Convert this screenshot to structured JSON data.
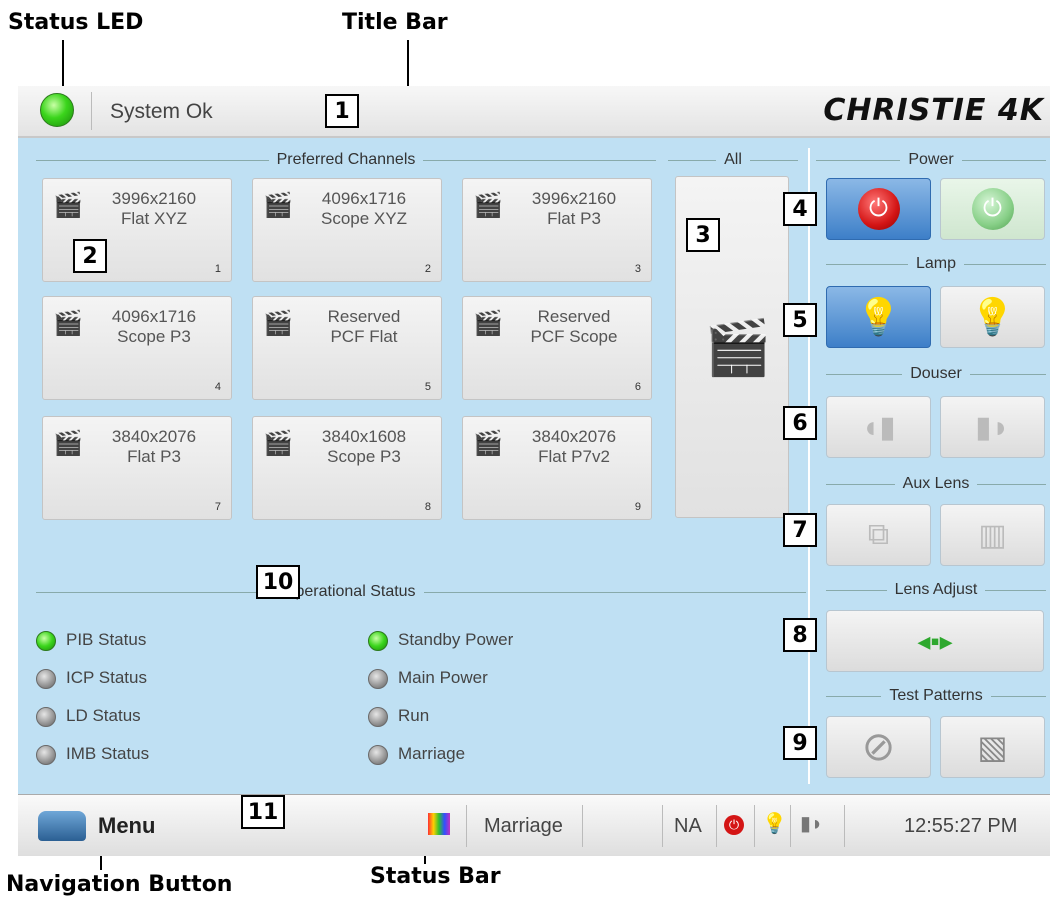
{
  "annotations": {
    "status_led": "Status LED",
    "title_bar": "Title Bar",
    "navigation_button": "Navigation Button",
    "status_bar": "Status Bar",
    "callout_numbers": [
      "1",
      "2",
      "3",
      "4",
      "5",
      "6",
      "7",
      "8",
      "9",
      "10",
      "11"
    ]
  },
  "title_bar": {
    "status_text": "System Ok",
    "brand": "CHRISTIE 4K",
    "status_led_color": "#3bd51c"
  },
  "preferred_channels": {
    "header": "Preferred Channels",
    "items": [
      {
        "line1": "3996x2160",
        "line2": "Flat XYZ",
        "number": "1"
      },
      {
        "line1": "4096x1716",
        "line2": "Scope XYZ",
        "number": "2"
      },
      {
        "line1": "3996x2160",
        "line2": "Flat P3",
        "number": "3"
      },
      {
        "line1": "4096x1716",
        "line2": "Scope P3",
        "number": "4"
      },
      {
        "line1": "Reserved",
        "line2": "PCF Flat",
        "number": "5"
      },
      {
        "line1": "Reserved",
        "line2": "PCF Scope",
        "number": "6"
      },
      {
        "line1": "3840x2076",
        "line2": "Flat P3",
        "number": "7"
      },
      {
        "line1": "3840x1608",
        "line2": "Scope P3",
        "number": "8"
      },
      {
        "line1": "3840x2076",
        "line2": "Flat P7v2",
        "number": "9"
      }
    ],
    "icon": "clapperboard-icon"
  },
  "all": {
    "header": "All",
    "icon": "clapperboards-icon"
  },
  "controls": {
    "power": {
      "header": "Power",
      "off_icon": "power-off-icon",
      "on_icon": "power-on-icon"
    },
    "lamp": {
      "header": "Lamp",
      "off_icon": "lamp-off-icon",
      "on_icon": "lamp-on-icon"
    },
    "douser": {
      "header": "Douser",
      "close_icon": "douser-close-icon",
      "open_icon": "douser-open-icon"
    },
    "aux_lens": {
      "header": "Aux Lens",
      "insert_icon": "aux-lens-insert-icon",
      "remove_icon": "aux-lens-remove-icon"
    },
    "lens_adjust": {
      "header": "Lens Adjust",
      "icon": "lens-adjust-arrows-icon"
    },
    "test_patterns": {
      "header": "Test Patterns",
      "off_icon": "no-pattern-icon",
      "pattern_icon": "test-pattern-icon"
    }
  },
  "operational_status": {
    "header": "Operational Status",
    "left": [
      {
        "label": "PIB Status",
        "state": "green"
      },
      {
        "label": "ICP Status",
        "state": "gray"
      },
      {
        "label": "LD Status",
        "state": "gray"
      },
      {
        "label": "IMB Status",
        "state": "gray"
      }
    ],
    "right": [
      {
        "label": "Standby Power",
        "state": "green"
      },
      {
        "label": "Main Power",
        "state": "gray"
      },
      {
        "label": "Run",
        "state": "gray"
      },
      {
        "label": "Marriage",
        "state": "gray"
      }
    ]
  },
  "status_bar": {
    "menu_label": "Menu",
    "marriage_label": "Marriage",
    "na_label": "NA",
    "time": "12:55:27 PM"
  },
  "colors": {
    "panel_bg": "#bfe0f3",
    "active_blue": "#3d7fc8",
    "power_red": "#d41515",
    "power_green": "#87cf87"
  }
}
